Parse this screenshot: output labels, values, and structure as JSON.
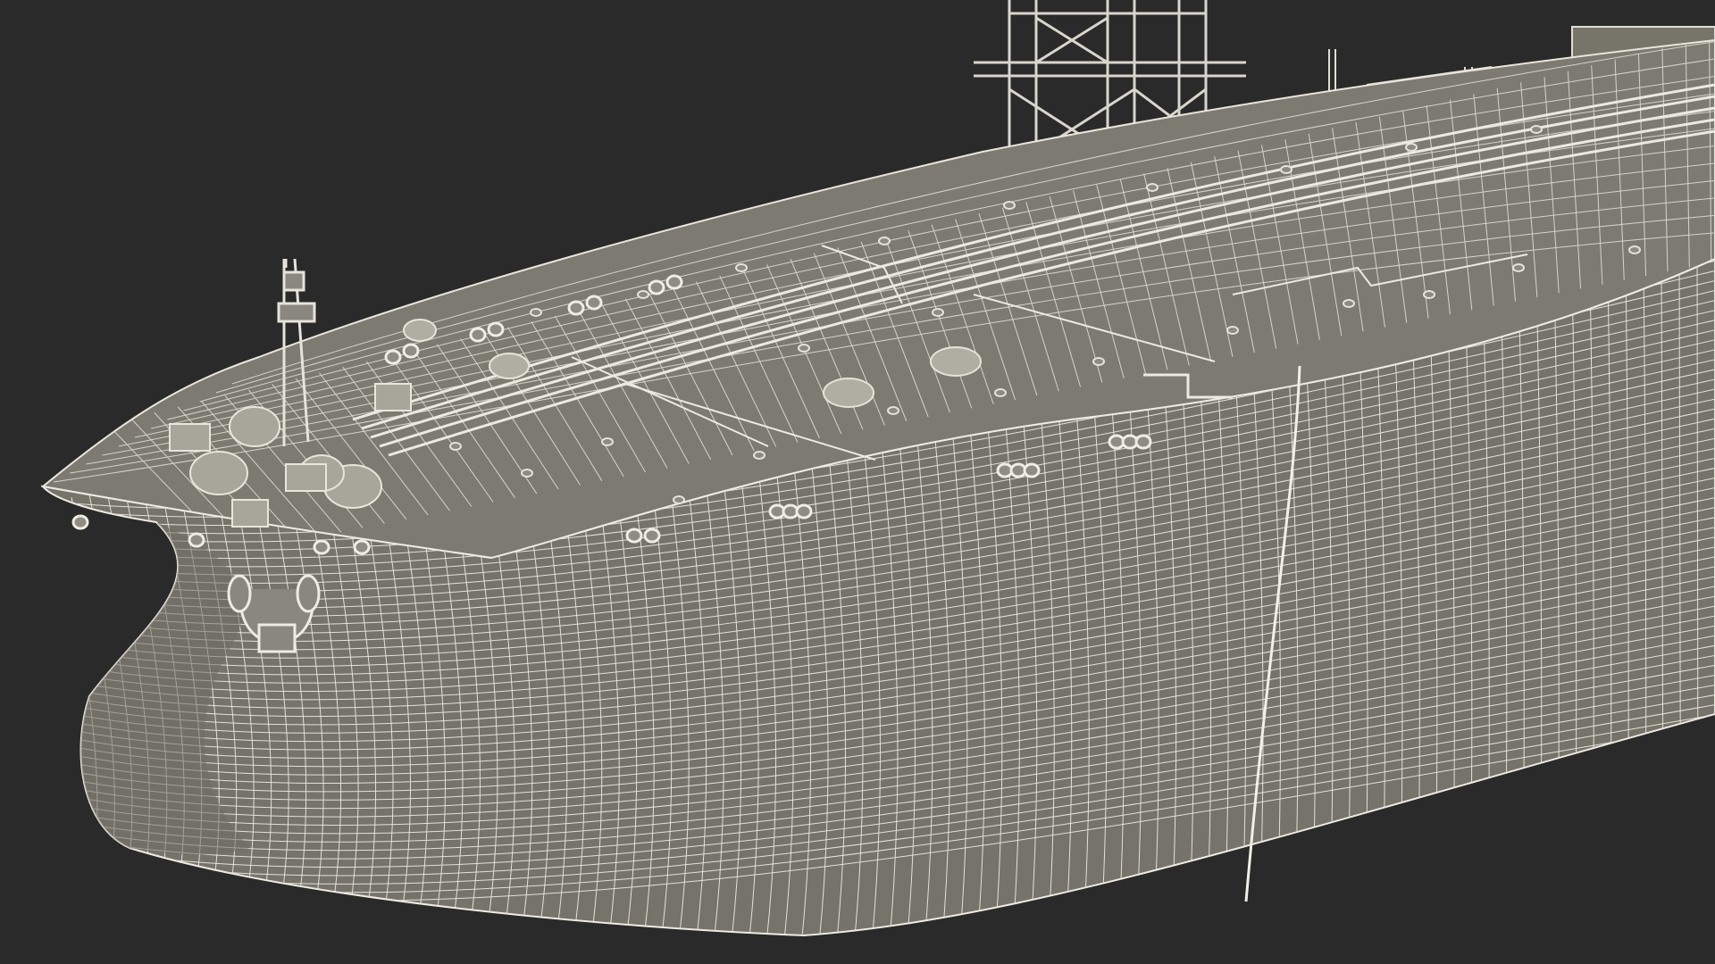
{
  "scene": {
    "subject": "oil-tanker-wireframe",
    "colors": {
      "background": "#2a2a2a",
      "hull": "#75736a",
      "hull_shade": "#6a685f",
      "deck": "#7c7a71",
      "wire": "#e8e6dc",
      "wire_dim": "#c9c7bc",
      "equipment": "#b5b3a8"
    }
  }
}
